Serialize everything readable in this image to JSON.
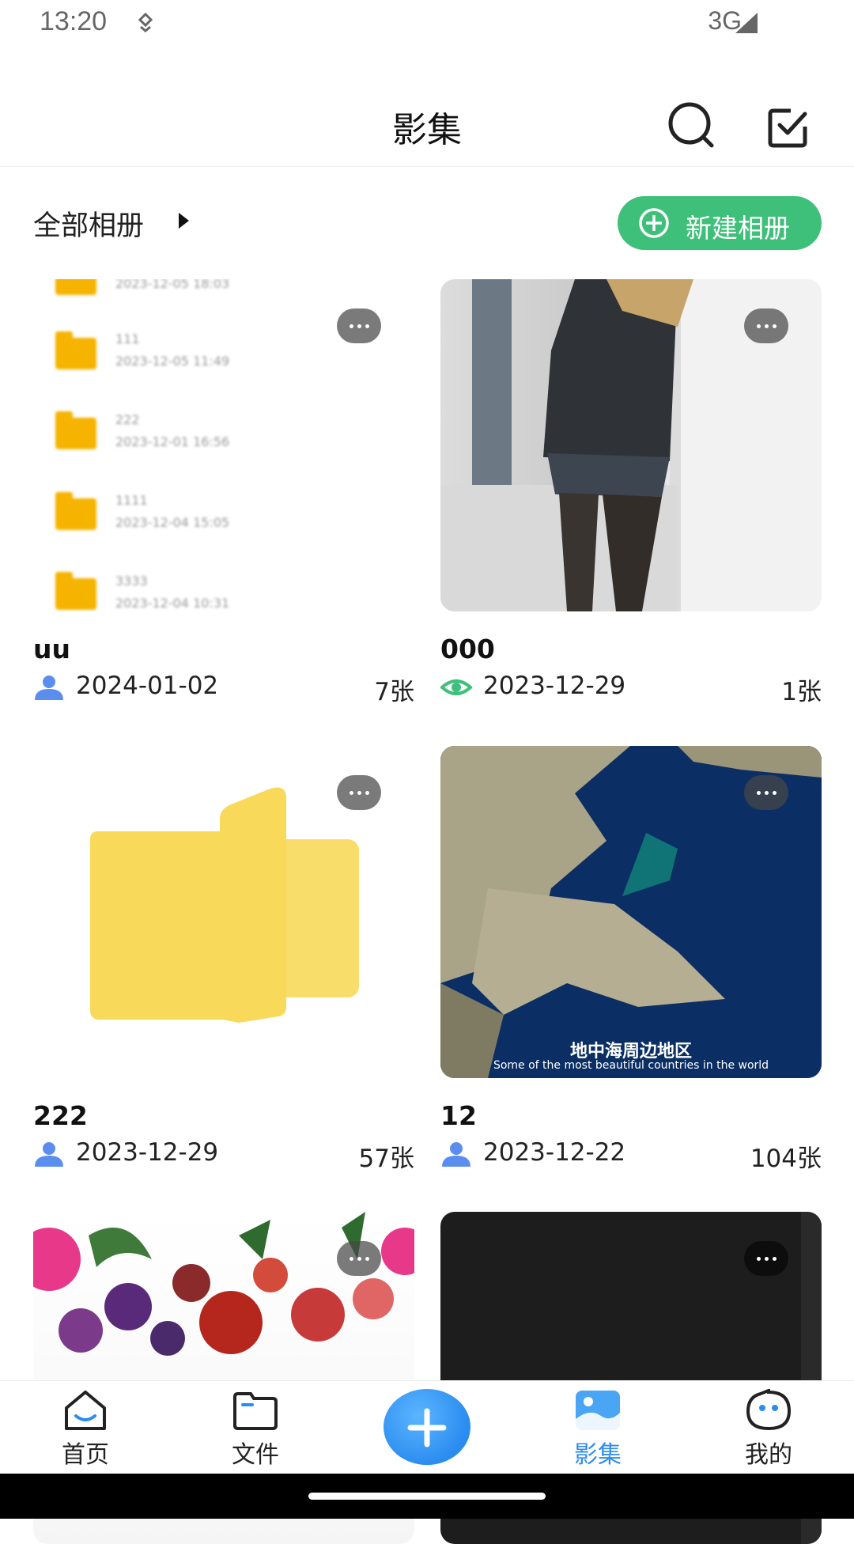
{
  "status_bar": {
    "time": "13:20",
    "network": "3G"
  },
  "header": {
    "title": "影集"
  },
  "album_bar": {
    "all_albums_label": "全部相册",
    "new_album_label": "新建相册"
  },
  "albums": [
    {
      "name": "uu",
      "date": "2024-01-02",
      "count": "7张",
      "owner_icon": "person-icon"
    },
    {
      "name": "000",
      "date": "2023-12-29",
      "count": "1张",
      "owner_icon": "eye-icon"
    },
    {
      "name": "222",
      "date": "2023-12-29",
      "count": "57张",
      "owner_icon": "person-icon"
    },
    {
      "name": "12",
      "date": "2023-12-22",
      "count": "104张",
      "owner_icon": "person-icon"
    },
    {
      "name": "",
      "date": "",
      "count": "",
      "owner_icon": ""
    },
    {
      "name": "",
      "date": "",
      "count": "",
      "owner_icon": ""
    }
  ],
  "thumb_text": {
    "folder_rows": [
      {
        "name": "",
        "date": "2023-12-05 18:03"
      },
      {
        "name": "111",
        "date": "2023-12-05 11:49"
      },
      {
        "name": "222",
        "date": "2023-12-01 16:56"
      },
      {
        "name": "1111",
        "date": "2023-12-04 15:05"
      },
      {
        "name": "3333",
        "date": "2023-12-04 10:31"
      }
    ],
    "sea_caption_cn": "地中海周边地区",
    "sea_caption_en": "Some of the most beautiful countries in the world"
  },
  "bottom_nav": [
    {
      "label": "首页",
      "icon": "home-icon"
    },
    {
      "label": "文件",
      "icon": "folder-icon"
    },
    {
      "label": "",
      "icon": "add-icon"
    },
    {
      "label": "影集",
      "icon": "gallery-icon",
      "active": true
    },
    {
      "label": "我的",
      "icon": "profile-face-icon"
    }
  ],
  "colors": {
    "accent_green": "#3fc07a",
    "accent_blue": "#2b8cf0",
    "person_icon_blue": "#5b8def"
  }
}
